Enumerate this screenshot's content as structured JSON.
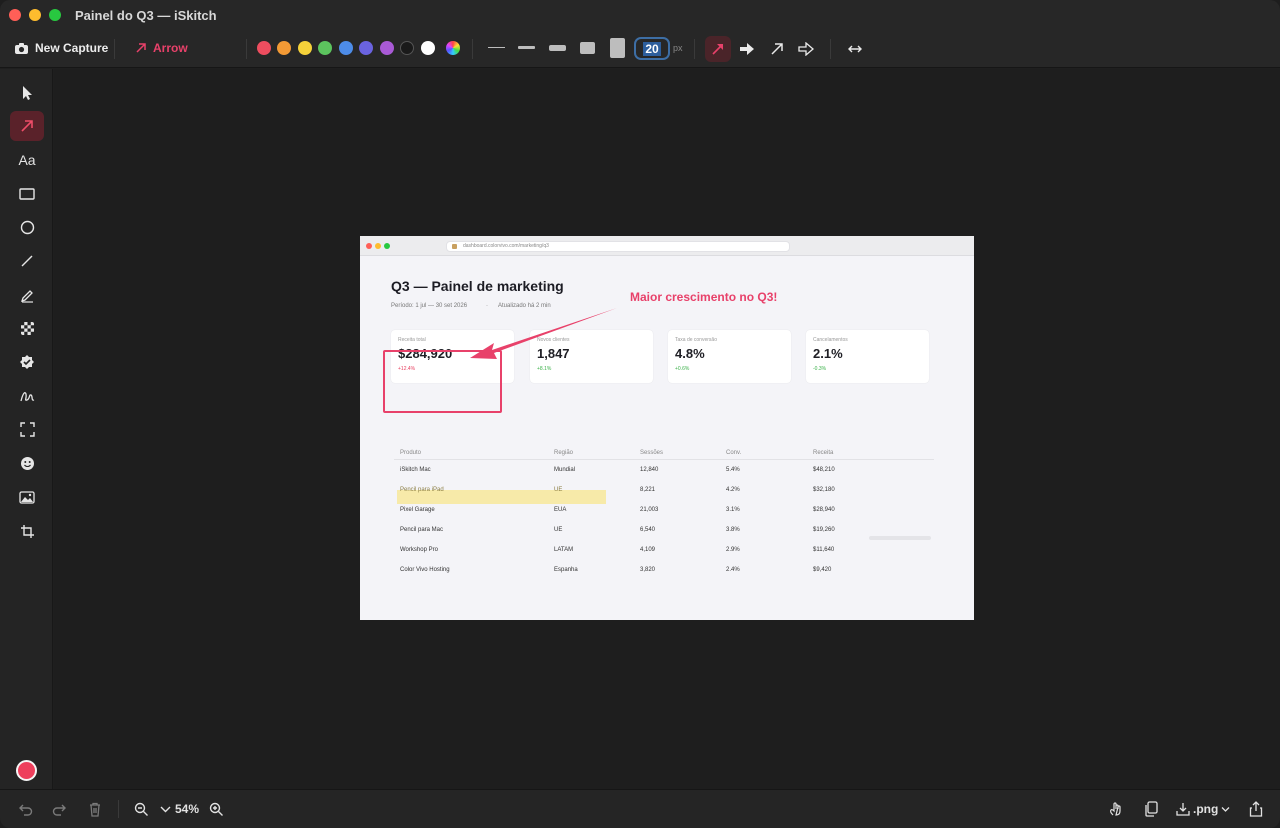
{
  "window": {
    "title": "Painel do Q3 — iSkitch"
  },
  "toolbar": {
    "new_capture_label": "New Capture",
    "tool_label": "Arrow",
    "colors": [
      "#ee4d5f",
      "#f39a35",
      "#f5d23a",
      "#5cc45e",
      "#4d8ce8",
      "#6a63e0",
      "#a95ad6",
      "#1a1a1a",
      "#ffffff"
    ],
    "stroke_width_value": "20",
    "stroke_width_unit": "px"
  },
  "sidebar": {
    "tools": [
      {
        "name": "select",
        "icon": "cursor-icon"
      },
      {
        "name": "arrow",
        "icon": "arrow-icon",
        "active": true
      },
      {
        "name": "text",
        "icon": "text-icon",
        "label": "Aa"
      },
      {
        "name": "rectangle",
        "icon": "rectangle-icon"
      },
      {
        "name": "ellipse",
        "icon": "circle-icon"
      },
      {
        "name": "line",
        "icon": "line-icon"
      },
      {
        "name": "highlighter",
        "icon": "pen-icon"
      },
      {
        "name": "pixelate",
        "icon": "checker-icon"
      },
      {
        "name": "stamp",
        "icon": "badge-check-icon"
      },
      {
        "name": "freehand",
        "icon": "scribble-icon"
      },
      {
        "name": "crop-region",
        "icon": "selection-icon"
      },
      {
        "name": "emoji",
        "icon": "smiley-icon"
      },
      {
        "name": "image",
        "icon": "image-icon"
      },
      {
        "name": "crop",
        "icon": "crop-icon"
      }
    ],
    "current_color": "#ee3f5c"
  },
  "bottombar": {
    "zoom": "54%",
    "format": ".png"
  },
  "screenshot": {
    "url": "dashboard.colorvivo.com/marketing/q3",
    "title": "Q3 — Painel de marketing",
    "period": "Período: 1 jul — 30 set 2026",
    "updated": "Atualizado há 2 min",
    "cards": [
      {
        "label": "Receita total",
        "value": "$284,920",
        "delta": "+12.4%",
        "delta_color": "#e84060"
      },
      {
        "label": "Novos clientes",
        "value": "1,847",
        "delta": "+8.1%",
        "delta_color": "#3cb24a"
      },
      {
        "label": "Taxa de conversão",
        "value": "4.8%",
        "delta": "+0.6%",
        "delta_color": "#3cb24a"
      },
      {
        "label": "Cancelamentos",
        "value": "2.1%",
        "delta": "-0.3%",
        "delta_color": "#3cb24a"
      }
    ],
    "table": {
      "headers": [
        "Produto",
        "Região",
        "Sessões",
        "Conv.",
        "Receita"
      ],
      "rows": [
        [
          "iSkitch Mac",
          "Mundial",
          "12,840",
          "5.4%",
          "$48,210"
        ],
        [
          "Pencil para iPad",
          "UE",
          "8,221",
          "4.2%",
          "$32,180"
        ],
        [
          "Pixel Garage",
          "EUA",
          "21,003",
          "3.1%",
          "$28,940"
        ],
        [
          "Pencil para Mac",
          "UE",
          "6,540",
          "3.8%",
          "$19,260"
        ],
        [
          "Workshop Pro",
          "LATAM",
          "4,109",
          "2.9%",
          "$11,640"
        ],
        [
          "Color Vivo Hosting",
          "Espanha",
          "3,820",
          "2.4%",
          "$9,420"
        ]
      ]
    }
  },
  "annotations": {
    "callout_text": "Maior crescimento no Q3!",
    "color": "#e8416a"
  }
}
